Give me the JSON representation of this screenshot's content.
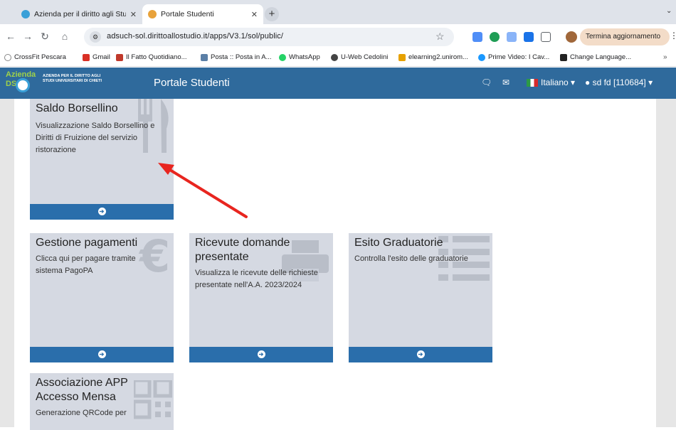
{
  "browser": {
    "tabs": [
      {
        "title": "Azienda per il diritto agli Stud",
        "active": false
      },
      {
        "title": "Portale Studenti",
        "active": true
      }
    ],
    "new_tab": "+",
    "tab_menu": "⌄",
    "url": "adsuch-sol.dirittoallostudio.it/apps/V3.1/sol/public/",
    "update_button": "Termina aggiornamento",
    "bookmarks": [
      {
        "label": "CrossFit Pescara",
        "color": "#888888"
      },
      {
        "label": "Gmail",
        "color": "#d93025"
      },
      {
        "label": "Il Fatto Quotidiano...",
        "color": "#c0392b"
      },
      {
        "label": "Posta :: Posta in A...",
        "color": "#5b7fa6"
      },
      {
        "label": "WhatsApp",
        "color": "#25d366"
      },
      {
        "label": "U-Web Cedolini",
        "color": "#444444"
      },
      {
        "label": "elearning2.unirom...",
        "color": "#e6a100"
      },
      {
        "label": "Prime Video: I Cav...",
        "color": "#1a98ff"
      },
      {
        "label": "Change Language...",
        "color": "#222222"
      }
    ],
    "bookmarks_more": "»"
  },
  "app": {
    "logo_word": "Azienda",
    "logo_dsu": "DSU",
    "logo_text": "AZIENDA PER IL DIRITTO AGLI STUDI UNIVERSITARI DI CHIETI",
    "title": "Portale Studenti",
    "language": "Italiano ▾",
    "user": "sd fd [110684] ▾"
  },
  "cards": [
    {
      "title": "Saldo Borsellino",
      "description": "Visualizzazione Saldo Borsellino e Diritti di Fruizione del servizio ristorazione",
      "icon": "fork-knife-icon"
    },
    {
      "title": "Gestione pagamenti",
      "description": "Clicca qui per pagare tramite sistema PagoPA",
      "icon": "euro-icon"
    },
    {
      "title": "Ricevute domande presentate",
      "description": "Visualizza le ricevute delle richieste presentate nell'A.A. 2023/2024",
      "icon": "printer-icon"
    },
    {
      "title": "Esito Graduatorie",
      "description": "Controlla l'esito delle graduatorie",
      "icon": "list-icon"
    },
    {
      "title": "Associazione APP Accesso Mensa",
      "description": "Generazione QRCode per",
      "icon": "qrcode-icon"
    }
  ],
  "annotation": {
    "color": "#e8251f"
  }
}
